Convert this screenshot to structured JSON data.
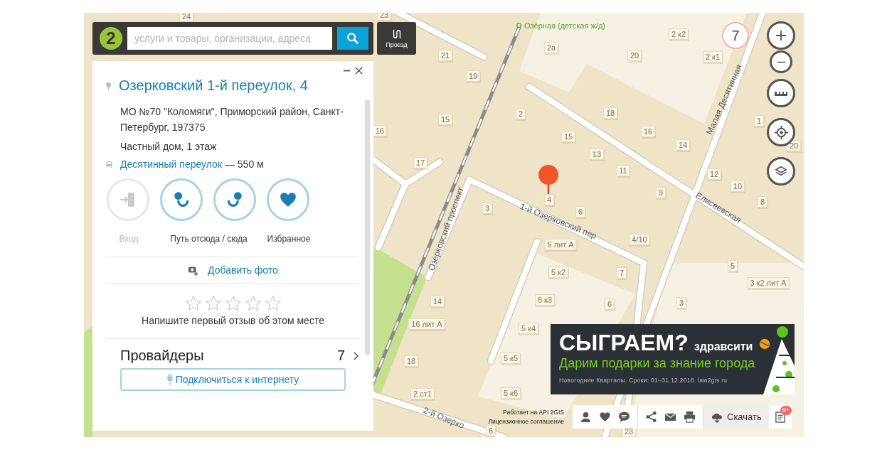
{
  "search": {
    "logo": "2",
    "placeholder": "услуги и товары, организации, адреса"
  },
  "route_button": {
    "label": "Проезд"
  },
  "card": {
    "title": "Озерковский 1-й переулок, 4",
    "address": "МО №70 \"Коломяги\", Приморский район, Санкт-Петербург, 197375",
    "description": "Частный дом, 1 этаж",
    "transit": {
      "stop": "Десятинный переулок",
      "distance": "— 550 м"
    },
    "actions": [
      {
        "kind": "entrance",
        "disabled": true
      },
      {
        "kind": "route_from",
        "disabled": false
      },
      {
        "kind": "route_to",
        "disabled": false
      },
      {
        "kind": "favorite",
        "disabled": false
      }
    ],
    "action_labels": [
      "Вход",
      "Путь отсюда / сюда",
      "Избранное"
    ],
    "add_photo": "Добавить фото",
    "rating": {
      "stars": 0,
      "prompt": "Напишите первый отзыв об этом месте"
    },
    "providers": {
      "title": "Провайдеры",
      "count": "7"
    },
    "connect_button": "Подключиться к интернету"
  },
  "map": {
    "zoom_level": "7",
    "station": "Озёрная (детская ж/д)",
    "streets": [
      "Малая Десятинная",
      "Елисеевская",
      "1-й Озерковский пер",
      "Озерковский проспект",
      "2-й Озерко"
    ],
    "houses": [
      "24",
      "23",
      "21",
      "19",
      "15",
      "16",
      "17",
      "2а",
      "20",
      "2 к2",
      "2 к1",
      "2",
      "18",
      "15",
      "16",
      "13",
      "11",
      "14",
      "1",
      "20",
      "12",
      "10",
      "8",
      "4",
      "6",
      "3",
      "9",
      "4/10",
      "5 лит А",
      "5 к2",
      "7",
      "5 к3",
      "6",
      "5 к4",
      "14",
      "16 лит А",
      "5 к5",
      "18",
      "5 к6",
      "2 ст1",
      "3",
      "5",
      "3 к2 лит А",
      "6",
      "23"
    ]
  },
  "banner": {
    "headline": "СЫГРАЕМ?",
    "brand": "здравсити",
    "tagline": "Дарим подарки за знание города",
    "footnote": "Новогодние Кварталы. Сроки: 01–31.12.2018. law2gis.ru"
  },
  "attribution": [
    "Работает на API 2GIS",
    "Лицензионное соглашение"
  ],
  "toolbar": {
    "download": "Скачать",
    "news_badge": "9+"
  }
}
